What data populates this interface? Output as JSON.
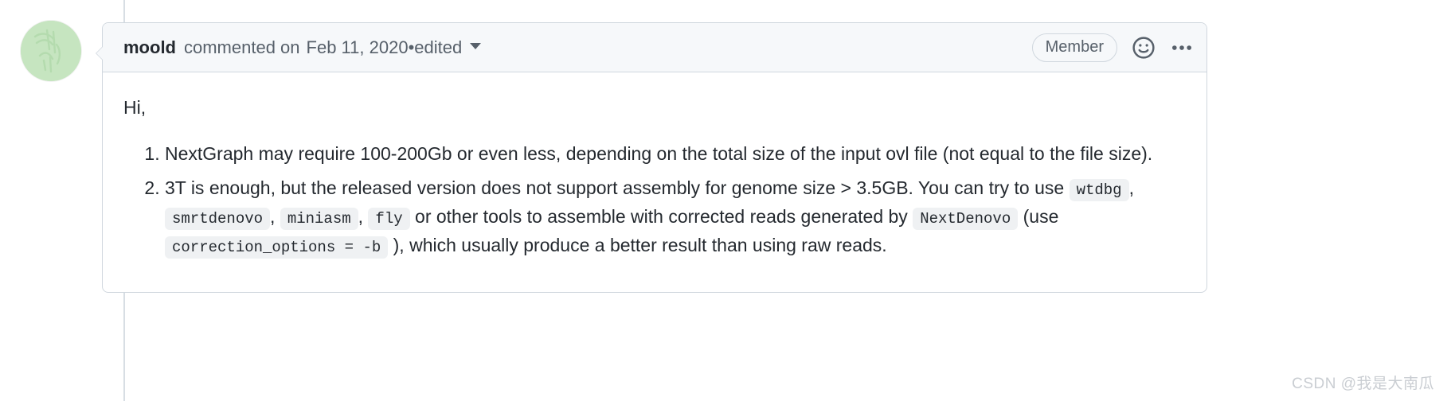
{
  "timeline": {
    "rail_color": "#d8dee4"
  },
  "avatar": {
    "name": "moold-avatar",
    "background_color": "#c6e5c0"
  },
  "comment": {
    "header": {
      "author": "moold",
      "action": "commented on",
      "date": "Feb 11, 2020",
      "separator": "•",
      "edited_label": "edited",
      "badge": "Member",
      "emoji_icon": "smiley-icon",
      "menu_icon": "kebab-horizontal-icon"
    },
    "body": {
      "greeting": "Hi,",
      "list": [
        {
          "number": "1.",
          "parts": [
            {
              "type": "text",
              "value": "NextGraph may require 100-200Gb or even less, depending on the total size of the input ovl file (not equal to the file size)."
            }
          ]
        },
        {
          "number": "2.",
          "parts": [
            {
              "type": "text",
              "value": "3T is enough, but the released version does not support assembly for genome size > 3.5GB. You can try to use "
            },
            {
              "type": "code",
              "value": "wtdbg"
            },
            {
              "type": "text",
              "value": ", "
            },
            {
              "type": "code",
              "value": "smrtdenovo"
            },
            {
              "type": "text",
              "value": ", "
            },
            {
              "type": "code",
              "value": "miniasm"
            },
            {
              "type": "text",
              "value": ", "
            },
            {
              "type": "code",
              "value": "fly"
            },
            {
              "type": "text",
              "value": " or other tools to assemble with corrected reads generated by "
            },
            {
              "type": "code",
              "value": "NextDenovo"
            },
            {
              "type": "text",
              "value": " (use "
            },
            {
              "type": "code",
              "value": "correction_options = -b"
            },
            {
              "type": "text",
              "value": " ), which usually produce a better result than using raw reads."
            }
          ]
        }
      ]
    }
  },
  "watermark": {
    "text": "CSDN @我是大南瓜"
  },
  "colors": {
    "header_background": "#f6f8fa",
    "border": "#d0d7de",
    "text": "#24292f",
    "muted_text": "#57606a",
    "code_background": "#eff1f3"
  }
}
